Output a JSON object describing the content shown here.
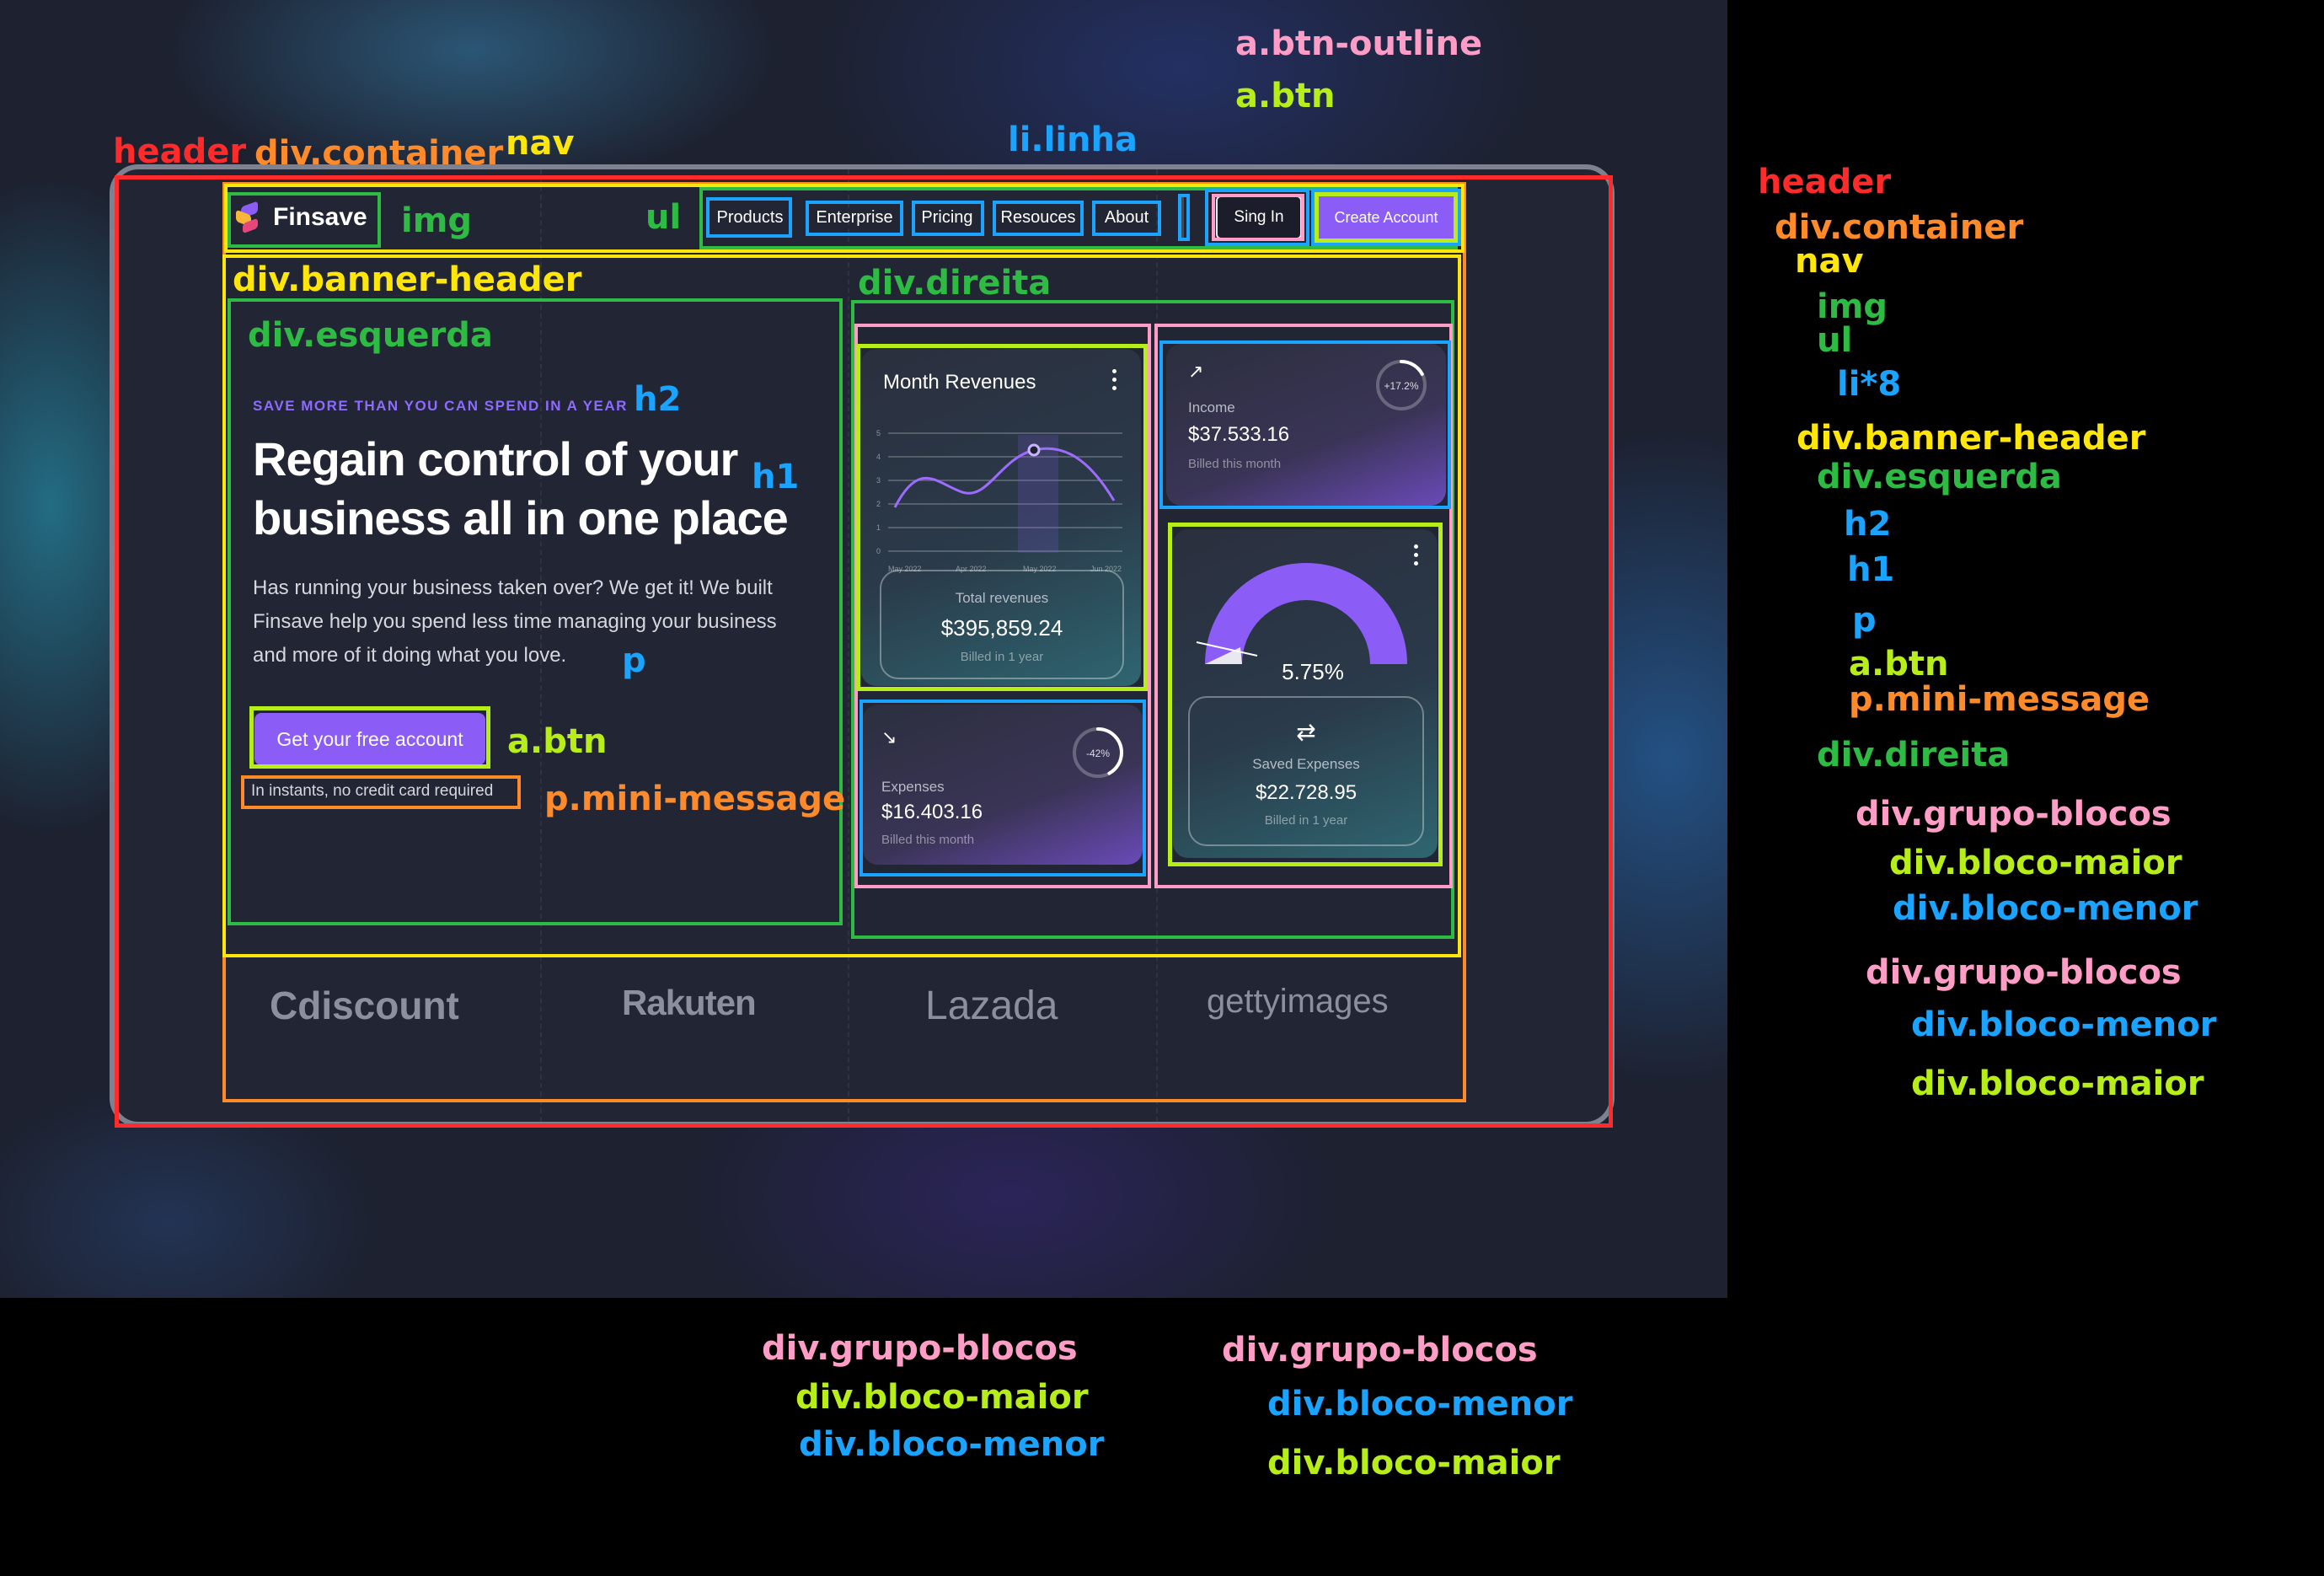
{
  "nav": {
    "brand": "Finsave",
    "links": [
      "Products",
      "Enterprise",
      "Pricing",
      "Resouces",
      "About"
    ],
    "signin": "Sing In",
    "create_account": "Create Account"
  },
  "hero": {
    "eyebrow": "SAVE MORE THAN YOU CAN SPEND IN A YEAR",
    "title_line1": "Regain control of your",
    "title_line2": "business all in one place",
    "paragraph_line1": "Has running your business taken over? We get it! We built",
    "paragraph_line2": "Finsave help you spend less time managing your business",
    "paragraph_line3": "and more of it doing what you love.",
    "cta": "Get your free account",
    "mini_message": "In instants, no credit card required"
  },
  "cards": {
    "revenues": {
      "title": "Month Revenues",
      "y_ticks": [
        "5",
        "4",
        "3",
        "2",
        "1",
        "0"
      ],
      "x_ticks": [
        "May 2022",
        "Apr 2022",
        "May 2022",
        "Jun 2022"
      ],
      "total_label": "Total revenues",
      "total_value": "$395,859.24",
      "total_sub": "Billed in 1 year"
    },
    "income": {
      "badge": "+17.2%",
      "label": "Income",
      "value": "$37.533.16",
      "sub": "Billed this month",
      "ring_fraction": 0.172
    },
    "expenses": {
      "badge": "-42%",
      "label": "Expenses",
      "value": "$16.403.16",
      "sub": "Billed this month",
      "ring_fraction": 0.42
    },
    "saved": {
      "gauge_value": "5.75%",
      "label": "Saved Expenses",
      "value": "$22.728.95",
      "sub": "Billed in 1 year"
    }
  },
  "brands": [
    "Cdiscount",
    "Rakuten",
    "Lazada",
    "gettyimages"
  ],
  "annotations": {
    "a_btn_outline": "a.btn-outline",
    "a_btn_top": "a.btn",
    "header": "header",
    "container": "div.container",
    "nav": "nav",
    "li_linha": "li.linha",
    "img": "img",
    "ul": "ul",
    "banner_header": "div.banner-header",
    "direita": "div.direita",
    "esquerda": "div.esquerda",
    "h2": "h2",
    "h1": "h1",
    "p": "p",
    "a_btn": "a.btn",
    "mini_message": "p.mini-message",
    "legend": [
      "header",
      "div.container",
      "nav",
      "img",
      "ul",
      "li*8",
      "div.banner-header",
      "div.esquerda",
      "h2",
      "h1",
      "p",
      "a.btn",
      "p.mini-message",
      "div.direita",
      "div.grupo-blocos",
      "div.bloco-maior",
      "div.bloco-menor",
      "div.grupo-blocos",
      "div.bloco-menor",
      "div.bloco-maior"
    ],
    "bottom_left": [
      "div.grupo-blocos",
      "div.bloco-maior",
      "div.bloco-menor"
    ],
    "bottom_right": [
      "div.grupo-blocos",
      "div.bloco-menor",
      "div.bloco-maior"
    ]
  },
  "colors": {
    "accent": "#8b5cf6",
    "background": "#222634",
    "header_box": "#ff2b2b",
    "container_box": "#ff8a2a",
    "nav_box": "#ffe60a",
    "esquerda_box": "#2dbb44",
    "item_box": "#1aa3ff",
    "btn_box": "#b7ee1a",
    "group_box": "#ff9dc6"
  }
}
